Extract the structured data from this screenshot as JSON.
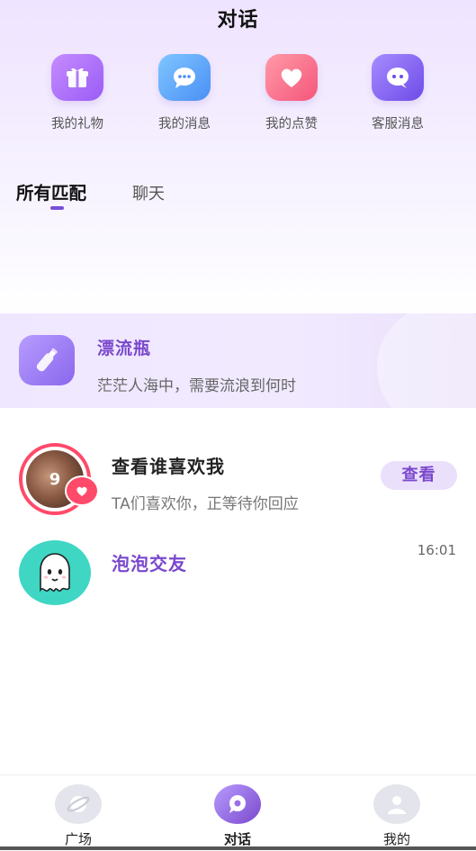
{
  "header": {
    "title": "对话"
  },
  "quick_actions": [
    {
      "label": "我的礼物",
      "icon": "gift-icon",
      "color_from": "#c58cff",
      "color_to": "#9a5cf5"
    },
    {
      "label": "我的消息",
      "icon": "chat-bubble-icon",
      "color_from": "#7fc6ff",
      "color_to": "#4a8ff5"
    },
    {
      "label": "我的点赞",
      "icon": "heart-icon",
      "color_from": "#ff9aa8",
      "color_to": "#f5567a"
    },
    {
      "label": "客服消息",
      "icon": "service-chat-icon",
      "color_from": "#a68cff",
      "color_to": "#6e4be8"
    }
  ],
  "tabs": [
    {
      "label": "所有匹配",
      "active": true
    },
    {
      "label": "聊天",
      "active": false
    }
  ],
  "drift_bottle": {
    "title": "漂流瓶",
    "subtitle": "茫茫人海中，需要流浪到何时",
    "icon": "bottle-icon"
  },
  "conversations": [
    {
      "avatar_number": "9",
      "title": "查看谁喜欢我",
      "subtitle": "TA们喜欢你，正等待你回应",
      "action": "查看",
      "badge_icon": "heart-icon"
    },
    {
      "title": "泡泡交友",
      "time": "16:01",
      "avatar_icon": "ghost-icon"
    }
  ],
  "tabbar": [
    {
      "label": "广场",
      "icon": "planet-icon",
      "active": false
    },
    {
      "label": "对话",
      "icon": "chat-icon",
      "active": true
    },
    {
      "label": "我的",
      "icon": "profile-icon",
      "active": false
    }
  ],
  "colors": {
    "accent": "#7a48cc",
    "badge": "#ff4a6a",
    "ghost_bg": "#3fd6c4"
  }
}
